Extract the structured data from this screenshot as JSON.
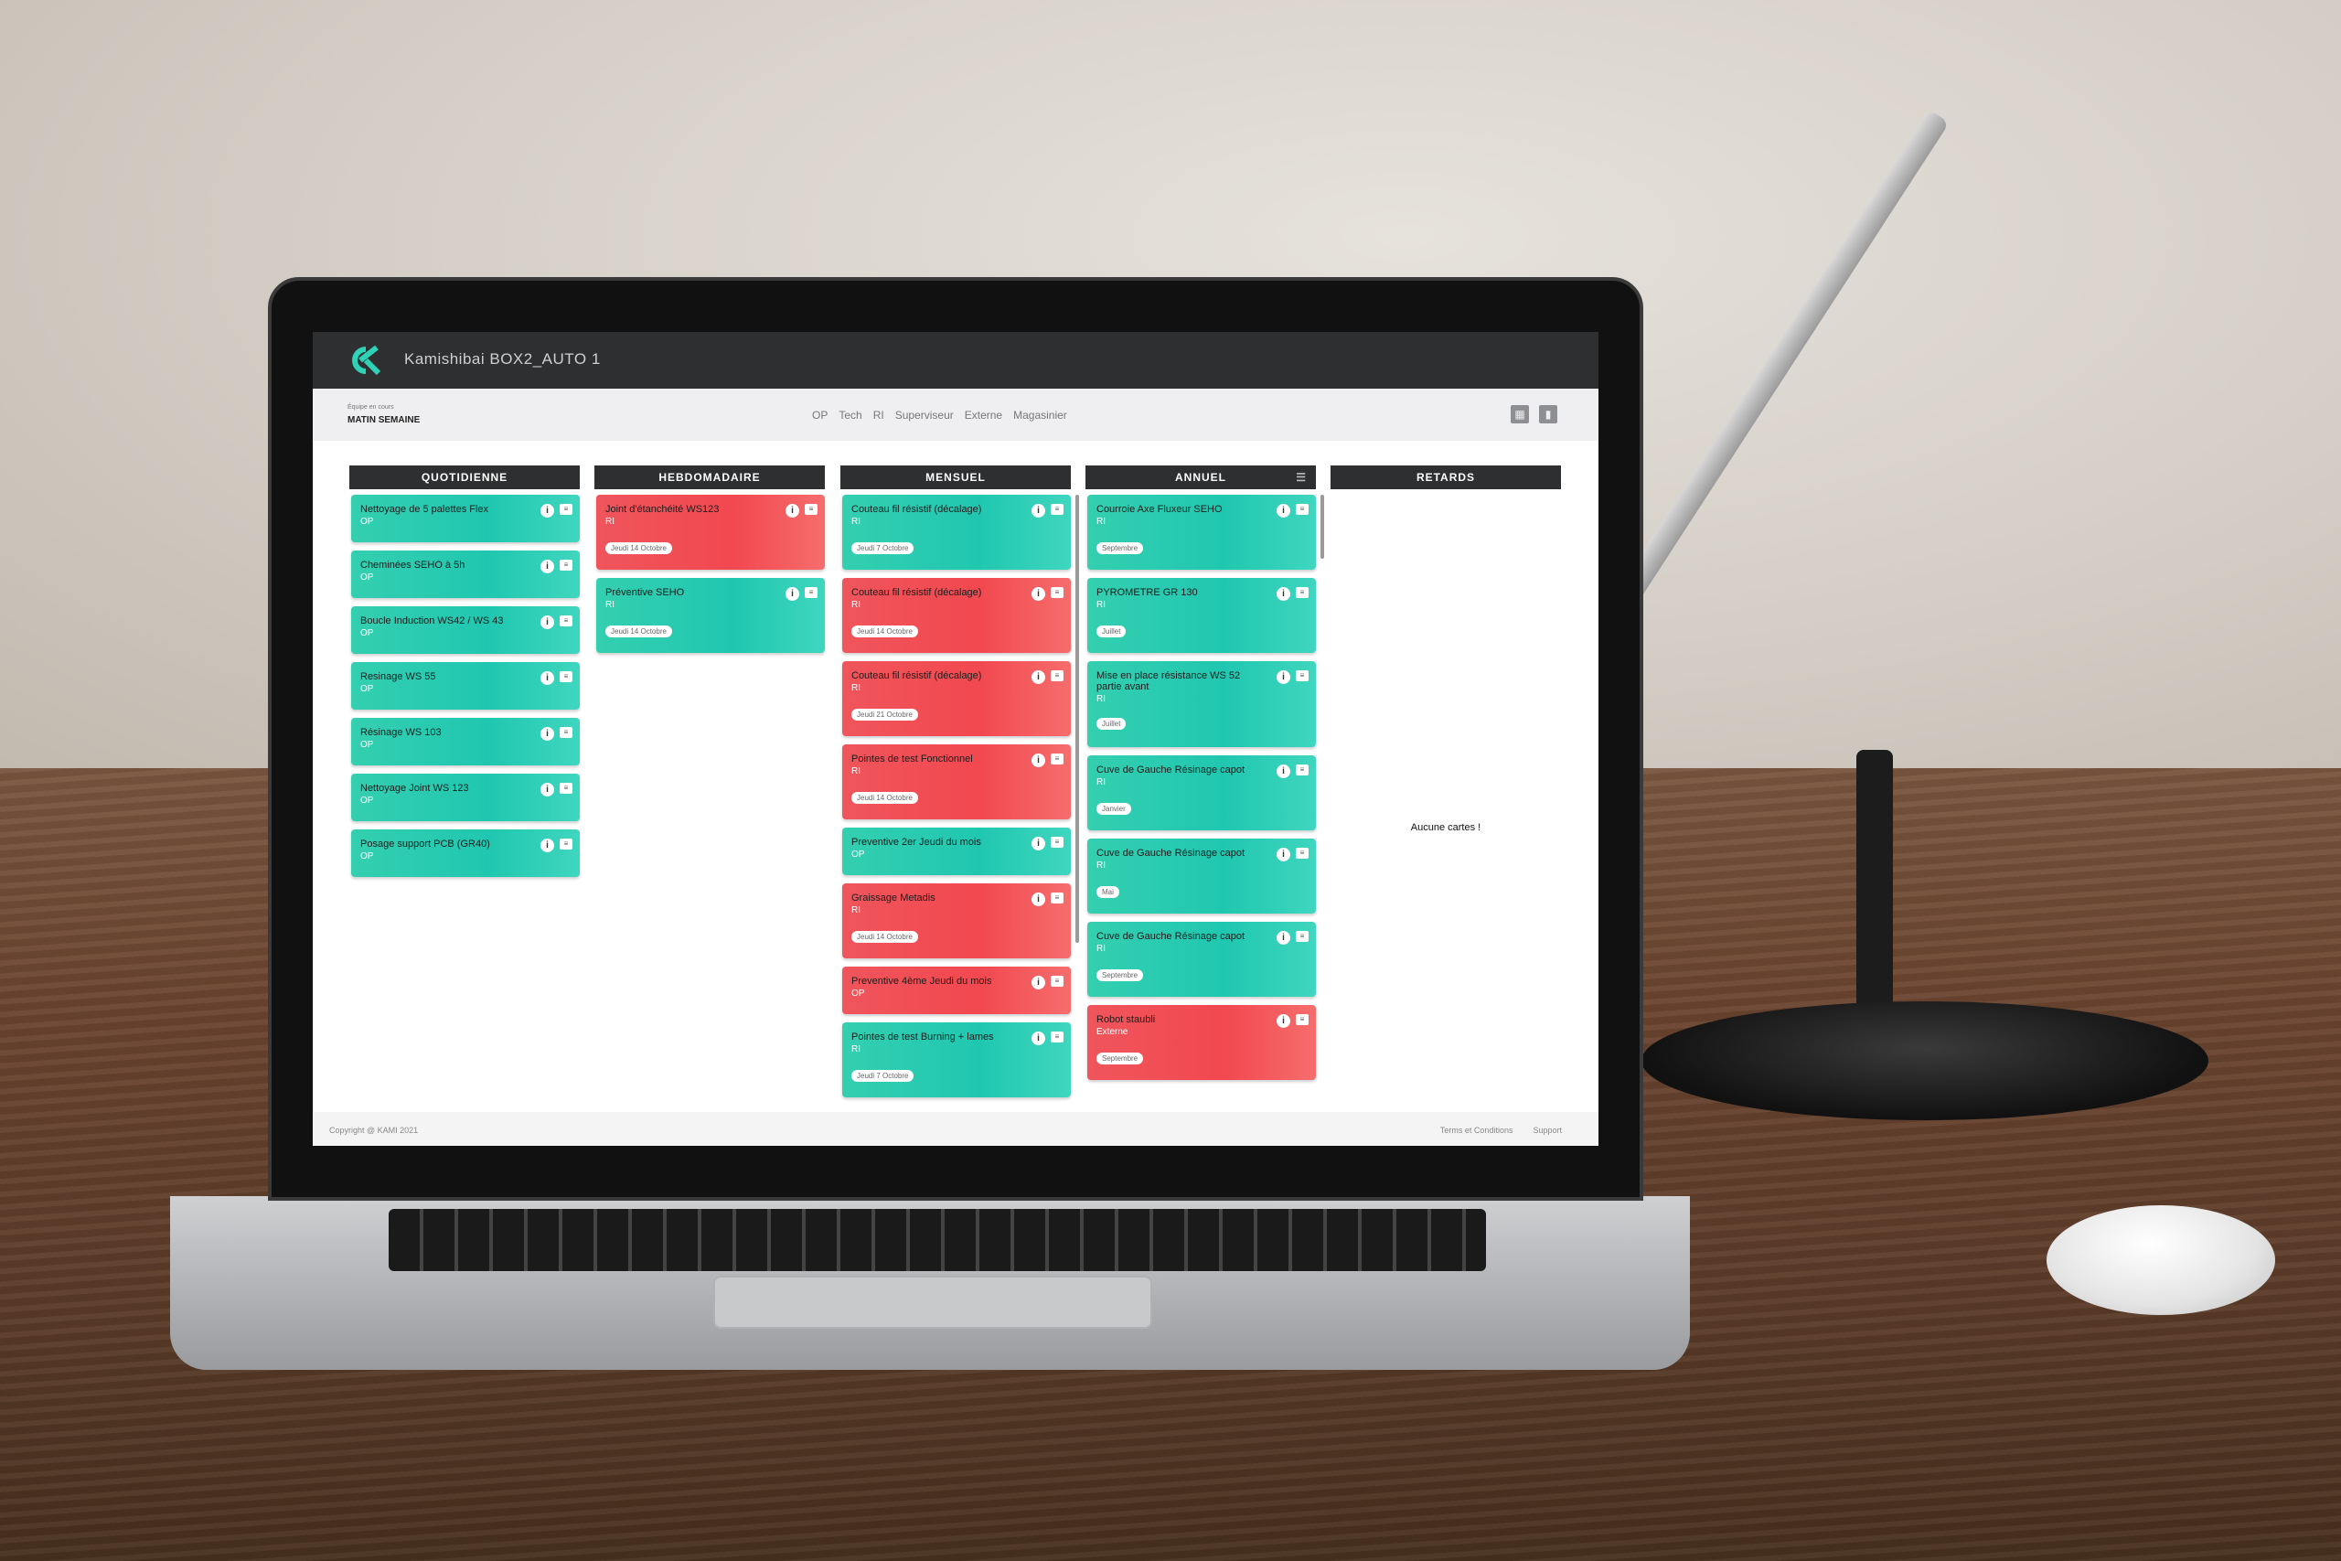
{
  "app": {
    "title": "Kamishibai BOX2_AUTO 1",
    "logo": "ck-logo-icon"
  },
  "team": {
    "label": "Équipe en cours",
    "value": "MATIN SEMAINE"
  },
  "nav": [
    "OP",
    "Tech",
    "RI",
    "Superviseur",
    "Externe",
    "Magasinier"
  ],
  "icons": {
    "messages": "chat-icon",
    "stats": "bar-chart-icon"
  },
  "columns": [
    {
      "title": "QUOTIDIENNE",
      "cards": [
        {
          "title": "Nettoyage de 5 palettes Flex",
          "who": "OP",
          "color": "green"
        },
        {
          "title": "Cheminées SEHO à 5h",
          "who": "OP",
          "color": "green"
        },
        {
          "title": "Boucle Induction WS42 / WS 43",
          "who": "OP",
          "color": "green"
        },
        {
          "title": "Resinage WS 55",
          "who": "OP",
          "color": "green"
        },
        {
          "title": "Résinage WS 103",
          "who": "OP",
          "color": "green"
        },
        {
          "title": "Nettoyage Joint WS 123",
          "who": "OP",
          "color": "green"
        },
        {
          "title": "Posage support PCB (GR40)",
          "who": "OP",
          "color": "green"
        }
      ]
    },
    {
      "title": "HEBDOMADAIRE",
      "cards": [
        {
          "title": "Joint d'étanchéité WS123",
          "who": "RI",
          "date": "Jeudi 14 Octobre",
          "color": "red"
        },
        {
          "title": "Préventive SEHO",
          "who": "RI",
          "date": "Jeudi 14 Octobre",
          "color": "green"
        }
      ]
    },
    {
      "title": "MENSUEL",
      "cards": [
        {
          "title": "Couteau fil résistif (décalage)",
          "who": "RI",
          "date": "Jeudi 7 Octobre",
          "color": "green"
        },
        {
          "title": "Couteau fil résistif (décalage)",
          "who": "RI",
          "date": "Jeudi 14 Octobre",
          "color": "red"
        },
        {
          "title": "Couteau fil résistif (décalage)",
          "who": "RI",
          "date": "Jeudi 21 Octobre",
          "color": "red"
        },
        {
          "title": "Pointes de test Fonctionnel",
          "who": "RI",
          "date": "Jeudi 14 Octobre",
          "color": "red"
        },
        {
          "title": "Preventive 2er Jeudi du mois",
          "who": "OP",
          "color": "green"
        },
        {
          "title": "Graissage Metadis",
          "who": "RI",
          "date": "Jeudi 14 Octobre",
          "color": "red"
        },
        {
          "title": "Preventive 4ème Jeudi du mois",
          "who": "OP",
          "color": "red"
        },
        {
          "title": "Pointes de test Burning + lames",
          "who": "RI",
          "date": "Jeudi 7 Octobre",
          "color": "green"
        }
      ]
    },
    {
      "title": "ANNUEL",
      "cards": [
        {
          "title": "Courroie Axe Fluxeur SEHO",
          "who": "RI",
          "date": "Septembre",
          "color": "green"
        },
        {
          "title": "PYROMETRE GR 130",
          "who": "RI",
          "date": "Juillet",
          "color": "green"
        },
        {
          "title": "Mise en place résistance WS 52 partie avant",
          "who": "RI",
          "date": "Juillet",
          "color": "green"
        },
        {
          "title": "Cuve de Gauche Résinage capot",
          "who": "RI",
          "date": "Janvier",
          "color": "green"
        },
        {
          "title": "Cuve de Gauche Résinage capot",
          "who": "RI",
          "date": "Mai",
          "color": "green"
        },
        {
          "title": "Cuve de Gauche Résinage capot",
          "who": "RI",
          "date": "Septembre",
          "color": "green"
        },
        {
          "title": "Robot staubli",
          "who": "Externe",
          "date": "Septembre",
          "color": "red"
        }
      ]
    },
    {
      "title": "RETARDS",
      "cards": [],
      "empty": "Aucune cartes !"
    }
  ],
  "footer": {
    "copyright": "Copyright @ KAMI 2021",
    "terms": "Terms et Conditions",
    "support": "Support"
  },
  "colors": {
    "green": "#2ccfb3",
    "red": "#f2484f",
    "topbar": "#2e2f31"
  }
}
